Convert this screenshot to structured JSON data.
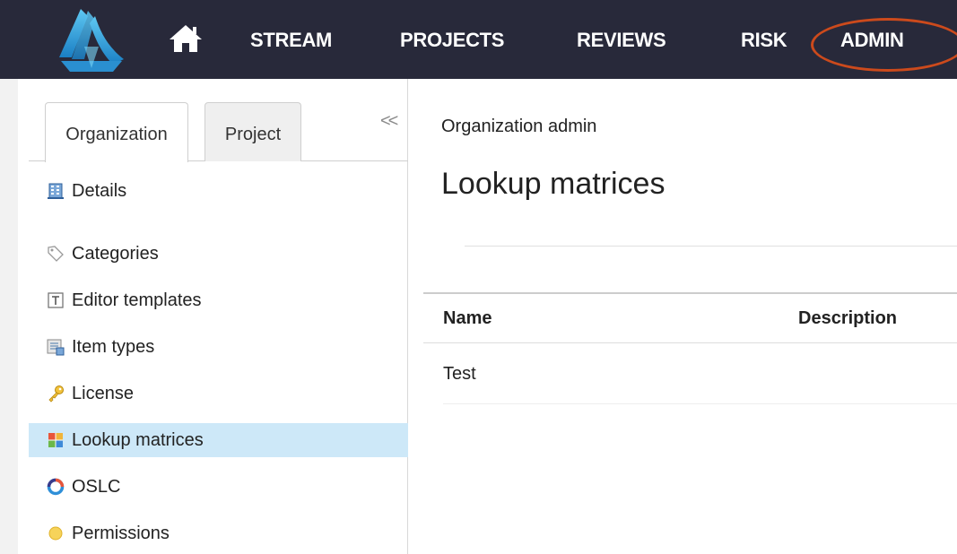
{
  "topnav": {
    "items": [
      "STREAM",
      "PROJECTS",
      "REVIEWS",
      "RISK",
      "ADMIN"
    ],
    "highlight_color": "#cc4a1c",
    "background": "#28293a"
  },
  "sidebar": {
    "tabs": [
      "Organization",
      "Project"
    ],
    "active_tab": "Organization",
    "collapse_glyph": "<<",
    "items": [
      {
        "label": "Details",
        "icon": "building-icon"
      },
      {
        "label": "Categories",
        "icon": "tag-icon"
      },
      {
        "label": "Editor templates",
        "icon": "template-icon"
      },
      {
        "label": "Item types",
        "icon": "item-types-icon"
      },
      {
        "label": "License",
        "icon": "key-icon"
      },
      {
        "label": "Lookup matrices",
        "icon": "matrix-icon"
      },
      {
        "label": "OSLC",
        "icon": "oslc-icon"
      },
      {
        "label": "Permissions",
        "icon": "permissions-icon"
      }
    ],
    "selected": "Lookup matrices",
    "selected_color": "#cde8f8"
  },
  "main": {
    "breadcrumb": "Organization admin",
    "title": "Lookup matrices",
    "table": {
      "headers": [
        "Name",
        "Description"
      ],
      "rows": [
        [
          "Test",
          ""
        ]
      ]
    }
  }
}
